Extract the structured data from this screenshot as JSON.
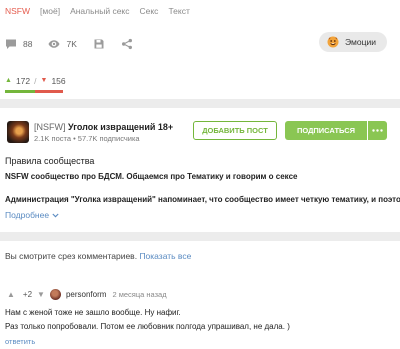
{
  "tags": [
    "NSFW",
    "[моё]",
    "Анальный секс",
    "Секс",
    "Текст"
  ],
  "actions": {
    "comments_count": "88",
    "views_count": "7K",
    "comments_icon": "comment-icon",
    "views_icon": "eye-icon",
    "save_icon": "save-icon",
    "share_icon": "share-icon"
  },
  "emotions": {
    "label": "Эмоции",
    "icon": "emotion-face-icon"
  },
  "rating": {
    "up": "172",
    "separator": "/",
    "down": "156",
    "up_color": "#74b63b",
    "down_color": "#e05a4c",
    "up_share": 0.52
  },
  "community": {
    "prefix": "[NSFW]",
    "name": "Уголок извращений 18+",
    "stats": "2.1K поста • 57.7K подписчика",
    "add_post": "ДОБАВИТЬ ПОСТ",
    "subscribe": "ПОДПИСАТЬСЯ",
    "accent_color": "#74b63b",
    "rules_title": "Правила сообщества",
    "rules_text": "NSFW сообщество про БДСМ. Общаемся про Тематику и говорим о сексе",
    "admin_text": "Администрация \"Уголка извращений\" напоминает, что сообщество имеет четкую тематику, и поэтому",
    "more_label": "Подробнее"
  },
  "comments": {
    "slice_text": "Вы смотрите срез комментариев.",
    "show_all": "Показать все",
    "item": {
      "score": "+2",
      "user": "personform",
      "time": "2 месяца назад",
      "line1": "Нам с женой тоже не зашло вообще. Ну нафиг.",
      "line2": "Раз только попробовали. Потом ее любовник полгода упрашивал, не дала. )",
      "reply": "ответить"
    }
  }
}
